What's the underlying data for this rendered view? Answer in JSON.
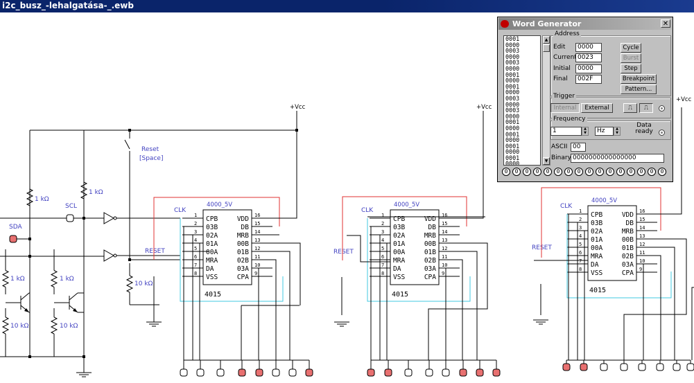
{
  "window": {
    "title": "i2c_busz_-lehalgatása-_.ewb"
  },
  "schematic": {
    "labels": {
      "vcc": "+Vcc",
      "reset_switch": "Reset",
      "reset_key": "[Space]",
      "sda": "SDA",
      "scl": "SCL",
      "r1k": "1 kΩ",
      "r10k": "10 kΩ",
      "clk": "CLK",
      "reset_net": "RESET",
      "chip_name": "4015",
      "chip_supply_a": "4000_5V",
      "chip_supply_b": "4000_5V"
    },
    "chip_pins_left": [
      {
        "num": "1",
        "name": "CPB"
      },
      {
        "num": "2",
        "name": "03B"
      },
      {
        "num": "3",
        "name": "02A"
      },
      {
        "num": "4",
        "name": "01A"
      },
      {
        "num": "5",
        "name": "00A"
      },
      {
        "num": "6",
        "name": "MRA"
      },
      {
        "num": "7",
        "name": "DA"
      },
      {
        "num": "8",
        "name": "VSS"
      }
    ],
    "chip_pins_right": [
      {
        "num": "16",
        "name": "VDD"
      },
      {
        "num": "15",
        "name": "DB"
      },
      {
        "num": "14",
        "name": "MRB"
      },
      {
        "num": "13",
        "name": "00B"
      },
      {
        "num": "12",
        "name": "01B"
      },
      {
        "num": "11",
        "name": "02B"
      },
      {
        "num": "10",
        "name": "03A"
      },
      {
        "num": "9",
        "name": "CPA"
      }
    ],
    "chips": [
      {
        "label": "4015",
        "supply": "4000_5V"
      },
      {
        "label": "4015",
        "supply": "4000_5V"
      },
      {
        "label": "4015",
        "supply": "4000_5V"
      }
    ],
    "probe_colors": {
      "on": "#e87070",
      "off": "#ffffff"
    },
    "wire_colors": {
      "main": "#000000",
      "clock": "#40c8e0",
      "reset": "#e03030",
      "label": "#4040c0"
    }
  },
  "word_generator": {
    "title": "Word Generator",
    "list": [
      "0001",
      "0000",
      "0003",
      "0000",
      "0003",
      "0000",
      "0001",
      "0000",
      "0001",
      "0000",
      "0003",
      "0000",
      "0003",
      "0000",
      "0001",
      "0000",
      "0001",
      "0000",
      "0001",
      "0000",
      "0001",
      "0000"
    ],
    "address": {
      "group": "Address",
      "edit_label": "Edit",
      "edit_value": "0000",
      "current_label": "Current",
      "current_value": "0023",
      "initial_label": "Initial",
      "initial_value": "0000",
      "final_label": "Final",
      "final_value": "002F"
    },
    "buttons": {
      "cycle": "Cycle",
      "burst": "Burst",
      "step": "Step",
      "breakpoint": "Breakpoint",
      "pattern": "Pattern..."
    },
    "trigger": {
      "group": "Trigger",
      "internal": "Internal",
      "external": "External"
    },
    "frequency": {
      "group": "Frequency",
      "value": "1",
      "unit": "Hz",
      "data_ready": "Data ready"
    },
    "ascii": {
      "label": "ASCII",
      "value": "00"
    },
    "binary": {
      "label": "Binary",
      "value": "0000000000000000"
    },
    "bits": [
      "0",
      "0",
      "0",
      "0",
      "0",
      "0",
      "0",
      "0",
      "0",
      "0",
      "0",
      "0",
      "0",
      "0",
      "0",
      "0"
    ],
    "close": "✕"
  }
}
